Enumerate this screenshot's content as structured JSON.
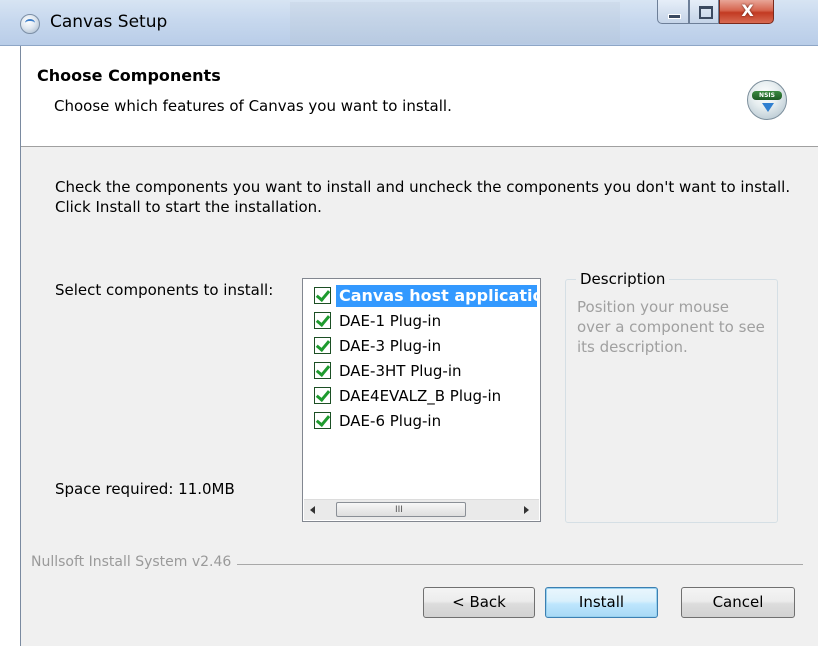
{
  "window": {
    "title": "Canvas Setup",
    "controls": {
      "minimize": "minimize",
      "maximize": "maximize",
      "close": "X"
    }
  },
  "header": {
    "title": "Choose Components",
    "subtitle": "Choose which features of Canvas you want to install.",
    "icon_band": "NSIS"
  },
  "body": {
    "instructions": "Check the components you want to install and uncheck the components you don't want to install. Click Install to start the installation.",
    "select_label": "Select components to install:",
    "space_required": "Space required: 11.0MB",
    "components": [
      {
        "label": "Canvas host application",
        "checked": true,
        "selected": true
      },
      {
        "label": "DAE-1 Plug-in",
        "checked": true,
        "selected": false
      },
      {
        "label": "DAE-3 Plug-in",
        "checked": true,
        "selected": false
      },
      {
        "label": "DAE-3HT Plug-in",
        "checked": true,
        "selected": false
      },
      {
        "label": "DAE4EVALZ_B Plug-in",
        "checked": true,
        "selected": false
      },
      {
        "label": "DAE-6 Plug-in",
        "checked": true,
        "selected": false
      }
    ],
    "scrollbar_grip": "III",
    "description": {
      "legend": "Description",
      "text": "Position your mouse over a component to see its description."
    }
  },
  "footer": {
    "branding": "Nullsoft Install System v2.46",
    "buttons": {
      "back": "< Back",
      "install": "Install",
      "cancel": "Cancel"
    }
  },
  "colors": {
    "selection": "#3399ff",
    "check": "#1e9b2e",
    "dialog_bg": "#f0f0f0",
    "default_button_border": "#3c7fb1"
  }
}
